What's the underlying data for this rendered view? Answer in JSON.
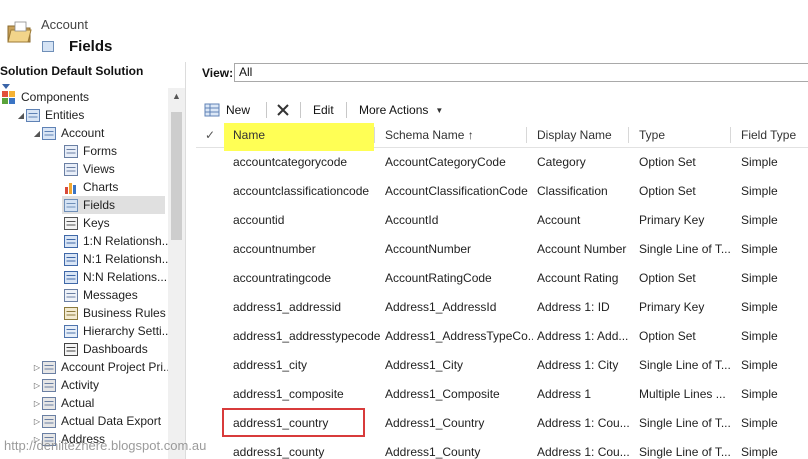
{
  "header": {
    "entity_name": "Account",
    "page_title": "Fields"
  },
  "left_panel": {
    "solution_title": "Solution Default Solution",
    "tree": [
      {
        "label": "Components",
        "icon": "components-icon",
        "expander": "",
        "indent": 0
      },
      {
        "label": "Entities",
        "icon": "entities-icon",
        "expander": "▲",
        "indent": 1
      },
      {
        "label": "Account",
        "icon": "account-entity-icon",
        "expander": "▲",
        "indent": 2
      },
      {
        "label": "Forms",
        "icon": "forms-icon",
        "expander": "",
        "indent": 3
      },
      {
        "label": "Views",
        "icon": "views-icon",
        "expander": "",
        "indent": 3
      },
      {
        "label": "Charts",
        "icon": "charts-icon",
        "expander": "",
        "indent": 3
      },
      {
        "label": "Fields",
        "icon": "fields-icon",
        "expander": "",
        "indent": 3,
        "selected": true
      },
      {
        "label": "Keys",
        "icon": "keys-icon",
        "expander": "",
        "indent": 3
      },
      {
        "label": "1:N Relationsh...",
        "icon": "relationship-icon",
        "expander": "",
        "indent": 3
      },
      {
        "label": "N:1 Relationsh...",
        "icon": "relationship-icon",
        "expander": "",
        "indent": 3
      },
      {
        "label": "N:N Relations...",
        "icon": "relationship-icon",
        "expander": "",
        "indent": 3
      },
      {
        "label": "Messages",
        "icon": "messages-icon",
        "expander": "",
        "indent": 3
      },
      {
        "label": "Business Rules",
        "icon": "business-rules-icon",
        "expander": "",
        "indent": 3
      },
      {
        "label": "Hierarchy Setti...",
        "icon": "hierarchy-icon",
        "expander": "",
        "indent": 3
      },
      {
        "label": "Dashboards",
        "icon": "dashboards-icon",
        "expander": "",
        "indent": 3
      },
      {
        "label": "Account Project Pri...",
        "icon": "entity-icon",
        "expander": "▷",
        "indent": 2
      },
      {
        "label": "Activity",
        "icon": "entity-icon",
        "expander": "▷",
        "indent": 2
      },
      {
        "label": "Actual",
        "icon": "entity-icon",
        "expander": "▷",
        "indent": 2
      },
      {
        "label": "Actual Data Export",
        "icon": "entity-icon",
        "expander": "▷",
        "indent": 2
      },
      {
        "label": "Address",
        "icon": "entity-icon",
        "expander": "▷",
        "indent": 2
      }
    ]
  },
  "view": {
    "label": "View:",
    "value": "All"
  },
  "toolbar": {
    "new_label": "New",
    "edit_label": "Edit",
    "more_actions_label": "More Actions"
  },
  "grid": {
    "columns": [
      "Name",
      "Schema Name ↑",
      "Display Name",
      "Type",
      "Field Type"
    ],
    "rows": [
      [
        "accountcategorycode",
        "AccountCategoryCode",
        "Category",
        "Option Set",
        "Simple"
      ],
      [
        "accountclassificationcode",
        "AccountClassificationCode",
        "Classification",
        "Option Set",
        "Simple"
      ],
      [
        "accountid",
        "AccountId",
        "Account",
        "Primary Key",
        "Simple"
      ],
      [
        "accountnumber",
        "AccountNumber",
        "Account Number",
        "Single Line of T...",
        "Simple"
      ],
      [
        "accountratingcode",
        "AccountRatingCode",
        "Account Rating",
        "Option Set",
        "Simple"
      ],
      [
        "address1_addressid",
        "Address1_AddressId",
        "Address 1: ID",
        "Primary Key",
        "Simple"
      ],
      [
        "address1_addresstypecode",
        "Address1_AddressTypeCo...",
        "Address 1: Add...",
        "Option Set",
        "Simple"
      ],
      [
        "address1_city",
        "Address1_City",
        "Address 1: City",
        "Single Line of T...",
        "Simple"
      ],
      [
        "address1_composite",
        "Address1_Composite",
        "Address 1",
        "Multiple Lines ...",
        "Simple"
      ],
      [
        "address1_country",
        "Address1_Country",
        "Address 1: Cou...",
        "Single Line of T...",
        "Simple"
      ],
      [
        "address1_county",
        "Address1_County",
        "Address 1: Cou...",
        "Single Line of T...",
        "Simple"
      ]
    ]
  },
  "watermark": "http://deniltezhere.blogspot.com.au",
  "colors": {
    "highlight_yellow": "#ffff55",
    "highlight_red": "#d83b3b",
    "selected_row": "#e0e0e0"
  }
}
